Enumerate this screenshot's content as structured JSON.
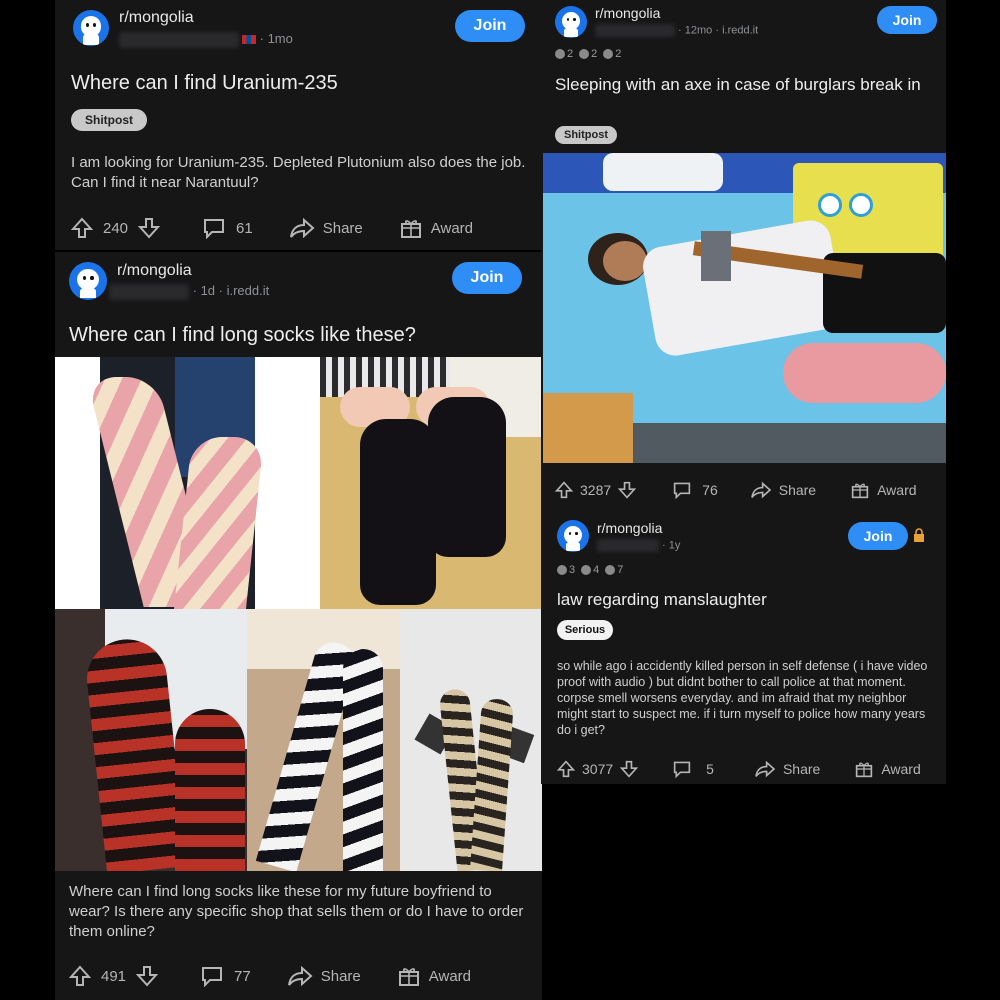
{
  "posts": [
    {
      "subreddit": "r/mongolia",
      "time": "1mo",
      "join_label": "Join",
      "title": "Where can I find Uranium-235",
      "flair": "Shitpost",
      "body": "I am looking for Uranium-235. Depleted Plutonium also does the job. Can I find it near Narantuul?",
      "votes": "240",
      "comments": "61",
      "share_label": "Share",
      "award_label": "Award"
    },
    {
      "subreddit": "r/mongolia",
      "time": "1d",
      "domain": "i.redd.it",
      "join_label": "Join",
      "title": "Where can I find long socks like these?",
      "body": "Where can I find long socks like these for my future boyfriend to wear? Is there any specific shop that sells them or do I have to order them online?",
      "votes": "491",
      "comments": "77",
      "share_label": "Share",
      "award_label": "Award"
    },
    {
      "subreddit": "r/mongolia",
      "time": "12mo",
      "domain": "i.redd.it",
      "join_label": "Join",
      "awards": [
        "2",
        "2",
        "2"
      ],
      "title": "Sleeping with an axe in case of burglars break in",
      "flair": "Shitpost",
      "votes": "3287",
      "comments": "76",
      "share_label": "Share",
      "award_label": "Award"
    },
    {
      "subreddit": "r/mongolia",
      "time": "1y",
      "join_label": "Join",
      "awards": [
        "3",
        "4",
        "7"
      ],
      "title": "law regarding manslaughter",
      "flair": "Serious",
      "body": "so while ago i accidently killed person in self defense ( i have video proof with audio )  but didnt bother to call police at that moment.  corpse smell worsens everyday. and im afraid that my neighbor might start to suspect me.  if i turn myself to police how many years do i get?",
      "votes": "3077",
      "comments": "5",
      "share_label": "Share",
      "award_label": "Award"
    }
  ],
  "colors": {
    "join": "#2f8ef5",
    "card": "#161617",
    "background": "#000000"
  },
  "icons": [
    "upvote-icon",
    "downvote-icon",
    "comment-icon",
    "share-icon",
    "award-icon",
    "lock-icon"
  ]
}
